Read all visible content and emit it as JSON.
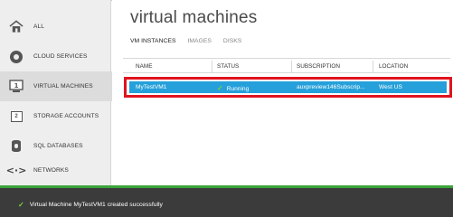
{
  "sidebar": {
    "items": [
      {
        "label": "ALL",
        "icon": "house-icon"
      },
      {
        "label": "CLOUD SERVICES",
        "icon": "cloud-service-icon"
      },
      {
        "label": "VIRTUAL MACHINES",
        "icon": "virtual-machine-icon",
        "active": true
      },
      {
        "label": "STORAGE ACCOUNTS",
        "icon": "storage-icon",
        "glyph": "2"
      },
      {
        "label": "SQL DATABASES",
        "icon": "database-icon"
      },
      {
        "label": "NETWORKS",
        "icon": "network-icon",
        "glyph": "<·>"
      }
    ]
  },
  "main": {
    "title": "virtual machines",
    "tabs": [
      {
        "label": "VM INSTANCES",
        "active": true
      },
      {
        "label": "IMAGES"
      },
      {
        "label": "DISKS"
      }
    ],
    "table": {
      "columns": [
        "NAME",
        "STATUS",
        "SUBSCRIPTION",
        "LOCATION"
      ],
      "rows": [
        {
          "name": "MyTestVM1",
          "status": "Running",
          "subscription": "auxpreview146Subscrip...",
          "location": "West US",
          "selected": true
        }
      ]
    }
  },
  "notification": {
    "text": "Virtual Machine MyTestVM1 created successfully"
  },
  "colors": {
    "selected_row": "#25a0da",
    "highlight_outline": "#e0141e",
    "status_ok": "#7ed23a",
    "notification_bar": "#3b3b3b",
    "notification_accent": "#3aa53a"
  }
}
